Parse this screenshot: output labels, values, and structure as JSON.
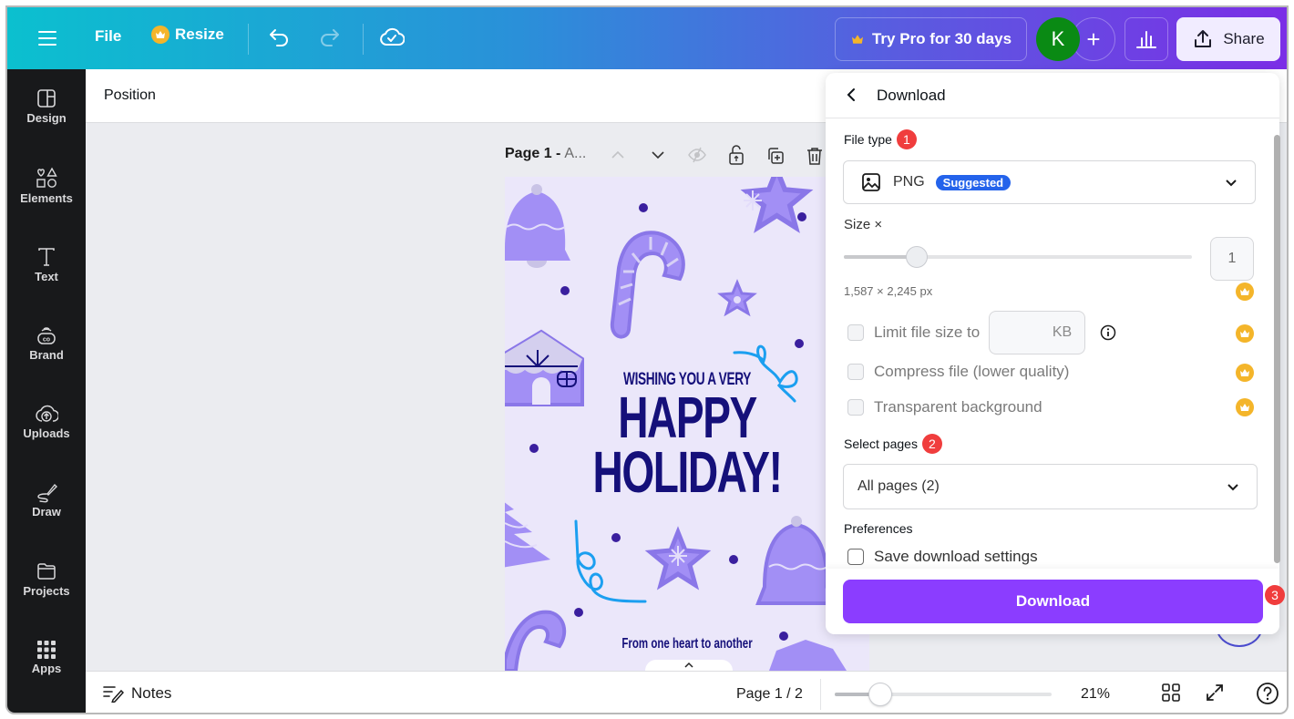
{
  "topbar": {
    "menu_icon": "hamburger-menu-icon",
    "file_label": "File",
    "resize_label": "Resize",
    "undo_icon": "undo-icon",
    "redo_icon": "redo-icon",
    "save_status_icon": "cloud-check-icon",
    "try_pro_label": "Try Pro for 30 days",
    "avatar_initial": "K",
    "avatar_color": "#0a8a14",
    "add_collaborator_label": "+",
    "insights_icon": "bar-chart-icon",
    "share_label": "Share"
  },
  "sidebar": {
    "items": [
      {
        "label": "Design",
        "icon": "layout-icon"
      },
      {
        "label": "Elements",
        "icon": "shapes-icon"
      },
      {
        "label": "Text",
        "icon": "text-icon"
      },
      {
        "label": "Brand",
        "icon": "brand-icon"
      },
      {
        "label": "Uploads",
        "icon": "cloud-upload-icon"
      },
      {
        "label": "Draw",
        "icon": "pen-icon"
      },
      {
        "label": "Projects",
        "icon": "folder-icon"
      },
      {
        "label": "Apps",
        "icon": "apps-grid-icon"
      }
    ]
  },
  "context_toolbar": {
    "position_label": "Position"
  },
  "canvas": {
    "page_title": "Page 1 -",
    "page_name": "A...",
    "card": {
      "line1": "WISHING YOU A VERY",
      "line2": "HAPPY",
      "line3": "HOLIDAY!",
      "footer": "From one heart to another",
      "background": "#ebe7fa",
      "text_color": "#15107a"
    },
    "page_tab_label": "^"
  },
  "download_panel": {
    "title": "Download",
    "file_type": {
      "label": "File type",
      "step": "1",
      "selected": "PNG",
      "badge": "Suggested"
    },
    "size": {
      "label": "Size ×",
      "value": "1",
      "slider_fraction": 0.21,
      "dimensions": "1,587 × 2,245 px"
    },
    "options": [
      {
        "label": "Limit file size to",
        "unit": "KB",
        "checked": false,
        "pro": true
      },
      {
        "label": "Compress file (lower quality)",
        "checked": false,
        "pro": true
      },
      {
        "label": "Transparent background",
        "checked": false,
        "pro": true
      }
    ],
    "select_pages": {
      "label": "Select pages",
      "step": "2",
      "selected": "All pages (2)"
    },
    "preferences": {
      "label": "Preferences",
      "save_settings_label": "Save download settings",
      "checked": false
    },
    "download_button": "Download",
    "download_step": "3",
    "accent_color": "#8b3dff"
  },
  "bottombar": {
    "notes_label": "Notes",
    "page_count": "Page 1 / 2",
    "zoom_level": "21%",
    "zoom_slider_fraction": 0.21,
    "grid_view_icon": "grid-view-icon",
    "fullscreen_icon": "expand-icon",
    "help_icon": "help-icon"
  }
}
